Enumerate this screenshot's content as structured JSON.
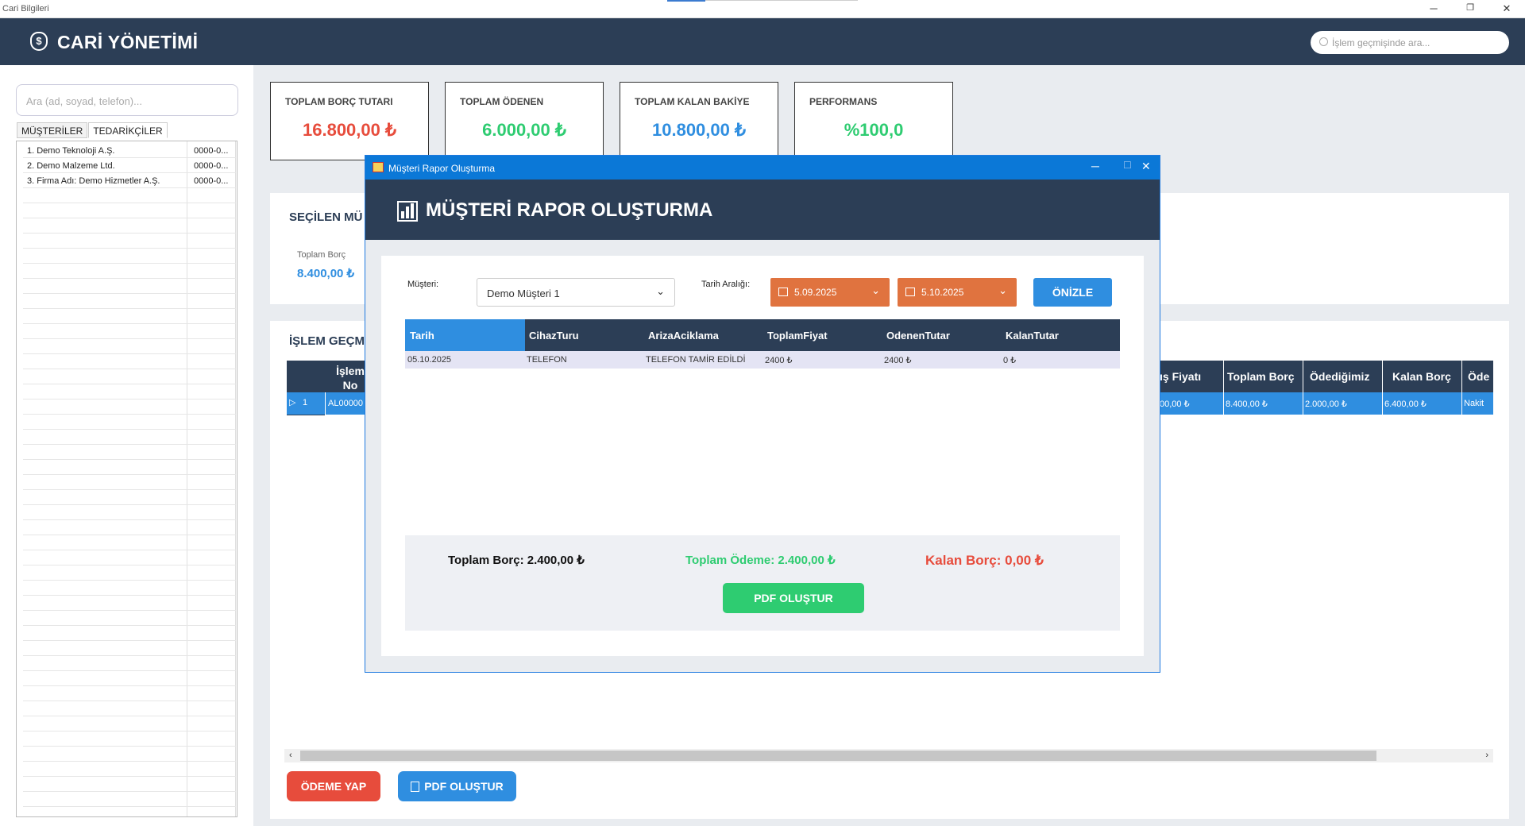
{
  "window": {
    "title": "Cari Bilgileri"
  },
  "header": {
    "title": "CARİ YÖNETİMİ",
    "search_placeholder": "İşlem geçmişinde ara...",
    "logo_glyph": "$"
  },
  "sidebar": {
    "search_placeholder": "Ara (ad, soyad, telefon)...",
    "tabs": [
      "MÜŞTERİLER",
      "TEDARİKÇİLER"
    ],
    "items": [
      {
        "name": "1.  Demo Teknoloji A.Ş.",
        "phone": "0000-0..."
      },
      {
        "name": "2.  Demo Malzeme Ltd.",
        "phone": "0000-0..."
      },
      {
        "name": "3. Firma Adı: Demo Hizmetler A.Ş.",
        "phone": "0000-0..."
      }
    ]
  },
  "cards": [
    {
      "label": "TOPLAM BORÇ TUTARI",
      "value": "16.800,00 ₺",
      "color": "#e74c3c"
    },
    {
      "label": "TOPLAM ÖDENEN",
      "value": "6.000,00 ₺",
      "color": "#2ecc71"
    },
    {
      "label": "TOPLAM KALAN BAKİYE",
      "value": "10.800,00 ₺",
      "color": "#2f8ee0"
    },
    {
      "label": "PERFORMANS",
      "value": "%100,0",
      "color": "#2ecc71"
    }
  ],
  "selected": {
    "title": "SEÇİLEN MÜ",
    "total_label": "Toplam Borç",
    "total_value": "8.400,00 ₺"
  },
  "history": {
    "title": "İŞLEM GEÇM",
    "col_islem_no": "İşlem No",
    "right_headers": [
      "ış Fiyatı",
      "Toplam Borç",
      "Ödediğimiz",
      "Kalan Borç",
      "Öde"
    ],
    "row": {
      "indicator": "▷",
      "num": "1",
      "islem_no": "AL00000",
      "satis": "00,00 ₺",
      "toplam": "8.400,00 ₺",
      "odedigimiz": "2.000,00 ₺",
      "kalan": "6.400,00 ₺",
      "odeme": "Nakit"
    }
  },
  "buttons": {
    "odeme": "ÖDEME YAP",
    "pdf": "PDF OLUŞTUR"
  },
  "colors": {
    "header": "#2c3e56",
    "red": "#e74c3c",
    "green": "#2ecc71",
    "blue": "#2f8ee0",
    "orange": "#e0733f"
  },
  "dialog": {
    "window_title": "Müşteri Rapor Oluşturma",
    "title": "MÜŞTERİ RAPOR OLUŞTURMA",
    "musteri_label": "Müşteri:",
    "musteri_value": "Demo  Müşteri 1",
    "tarih_label": "Tarih Aralığı:",
    "date_from": "5.09.2025",
    "date_to": "5.10.2025",
    "preview_button": "ÖNİZLE",
    "columns": [
      "Tarih",
      "CihazTuru",
      "ArizaAciklama",
      "ToplamFiyat",
      "OdenenTutar",
      "KalanTutar"
    ],
    "rows": [
      [
        "05.10.2025",
        "TELEFON",
        "TELEFON TAMİR EDİLDİ",
        "2400 ₺",
        "2400 ₺",
        "0 ₺"
      ]
    ],
    "total_borc": "Toplam Borç: 2.400,00 ₺",
    "total_odeme": "Toplam Ödeme: 2.400,00 ₺",
    "kalan_borc": "Kalan Borç: 0,00 ₺",
    "pdf_button": "PDF OLUŞTUR"
  }
}
